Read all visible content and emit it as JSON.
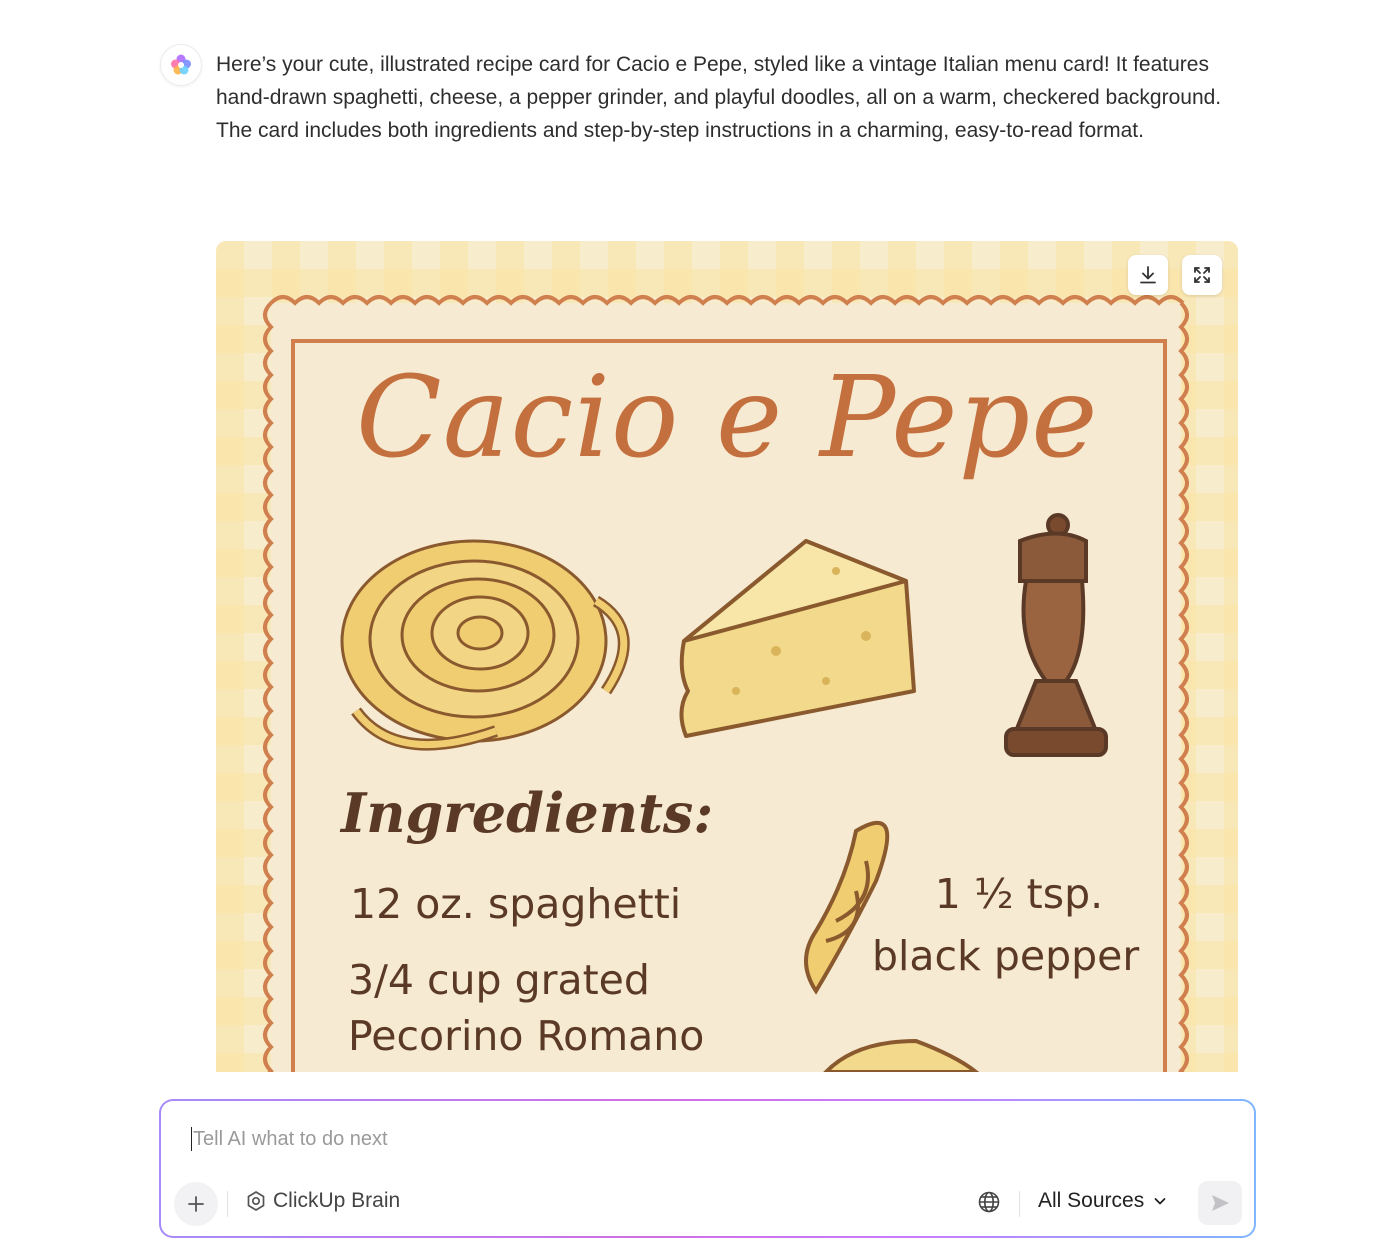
{
  "assistant": {
    "avatar_icon": "clickup-brain-icon",
    "message": "Here’s your cute, illustrated recipe card for Cacio e Pepe, styled like a vintage Italian menu card! It features hand-drawn spaghetti, cheese, a pepper grinder, and playful doodles, all on a warm, checkered background. The card includes both ingredients and step-by-step instructions in a charming, easy-to-read format."
  },
  "image": {
    "title": "Cacio e Pepe",
    "section_title": "Ingredients:",
    "ingredients": {
      "spaghetti": "12 oz. spaghetti",
      "cheese_line1": "3/4 cup grated",
      "cheese_line2": "Pecorino Romano",
      "pepper_line1": "1 ½ tsp.",
      "pepper_line2": "black pepper"
    },
    "actions": {
      "download_icon": "download-icon",
      "expand_icon": "expand-icon"
    },
    "colors": {
      "title": "#c4703e",
      "text": "#5a3a26",
      "border": "#d0804f",
      "background": "#f7eccb"
    }
  },
  "composer": {
    "placeholder": "Tell AI what to do next",
    "brain_label": "ClickUp Brain",
    "sources_label": "All Sources",
    "icons": {
      "add": "plus-icon",
      "brain": "brain-icon",
      "web": "globe-icon",
      "dropdown": "chevron-down-icon",
      "send": "send-icon"
    }
  }
}
